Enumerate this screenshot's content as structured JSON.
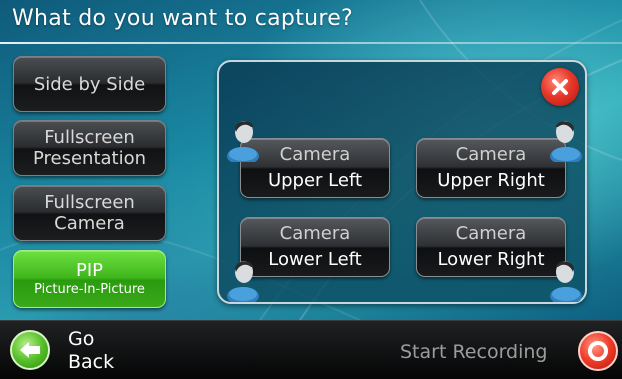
{
  "header": {
    "title": "What do you want to capture?"
  },
  "modes": [
    {
      "line1": "Side by Side",
      "line2": "",
      "selected": false
    },
    {
      "line1": "Fullscreen",
      "line2": "Presentation",
      "selected": false
    },
    {
      "line1": "Fullscreen",
      "line2": "Camera",
      "selected": false
    },
    {
      "line1": "PIP",
      "line2": "Picture-In-Picture",
      "selected": true
    }
  ],
  "pip_positions": [
    {
      "line1": "Camera",
      "line2": "Upper Left"
    },
    {
      "line1": "Camera",
      "line2": "Upper Right"
    },
    {
      "line1": "Camera",
      "line2": "Lower Left"
    },
    {
      "line1": "Camera",
      "line2": "Lower Right"
    }
  ],
  "icons": {
    "close": "close-icon",
    "back": "back-arrow-icon",
    "record": "record-icon",
    "person": "person-icon"
  },
  "footer": {
    "back_line1": "Go",
    "back_line2": "Back",
    "record_label": "Start Recording"
  },
  "colors": {
    "selected_green": "#3eb61b",
    "close_red": "#e8392a",
    "record_red": "#ee3b28",
    "background_teal": "#1a88a2"
  }
}
